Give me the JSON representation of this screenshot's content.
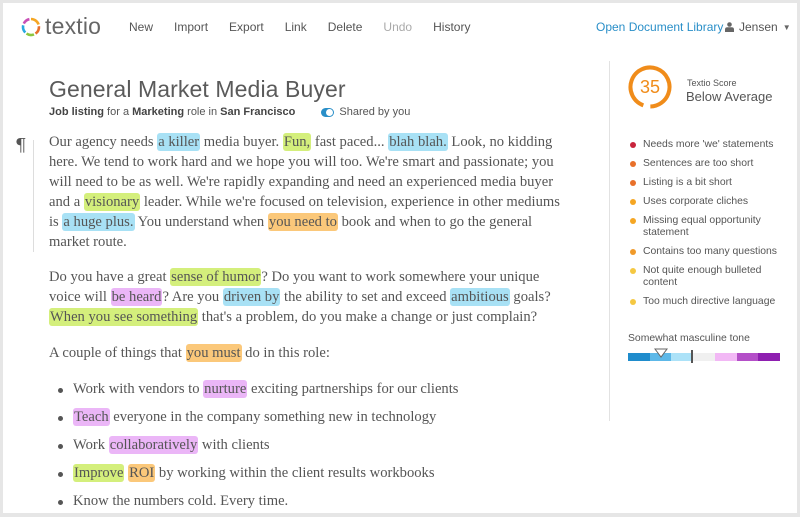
{
  "app": {
    "name": "textio"
  },
  "nav": {
    "items": [
      {
        "label": "New",
        "disabled": false
      },
      {
        "label": "Import",
        "disabled": false
      },
      {
        "label": "Export",
        "disabled": false
      },
      {
        "label": "Link",
        "disabled": false
      },
      {
        "label": "Delete",
        "disabled": false
      },
      {
        "label": "Undo",
        "disabled": true
      },
      {
        "label": "History",
        "disabled": false
      }
    ],
    "document_library": "Open Document Library",
    "user": "Jensen",
    "user_icon": "user-icon",
    "user_caret": "caret-down-icon"
  },
  "document": {
    "title": "General Market Media Buyer",
    "subtitle": {
      "prefix": "Job listing",
      "for_a": " for a ",
      "role": "Marketing",
      "role_in": " role in ",
      "location": "San Francisco"
    },
    "shared_label": "Shared by you",
    "pilcrow": "¶",
    "paragraphs": [
      [
        {
          "t": "Our agency needs "
        },
        {
          "t": "a killer",
          "hl": "blue"
        },
        {
          "t": " media buyer. "
        },
        {
          "t": "Fun,",
          "hl": "green"
        },
        {
          "t": " fast paced... "
        },
        {
          "t": "blah blah.",
          "hl": "blue"
        },
        {
          "t": " Look, no kidding here. We tend to work hard and we hope you will too. We're smart and passionate; you will need to be as well. We're rapidly expanding and need an experienced media buyer and a "
        },
        {
          "t": "visionary",
          "hl": "green"
        },
        {
          "t": " leader. While we're focused on television, experience in other mediums is "
        },
        {
          "t": "a huge plus.",
          "hl": "blue"
        },
        {
          "t": " You understand when "
        },
        {
          "t": "you need to",
          "hl": "orange"
        },
        {
          "t": " book and when to go the general market route."
        }
      ],
      [
        {
          "t": "Do you have a great "
        },
        {
          "t": "sense of humor",
          "hl": "green"
        },
        {
          "t": "? Do you want to work somewhere your unique voice will "
        },
        {
          "t": "be heard",
          "hl": "purple"
        },
        {
          "t": "? Are you "
        },
        {
          "t": "driven by",
          "hl": "blue"
        },
        {
          "t": " the ability to set and exceed "
        },
        {
          "t": "ambitious",
          "hl": "blue"
        },
        {
          "t": " goals? "
        },
        {
          "t": "When you see something",
          "hl": "green"
        },
        {
          "t": " that's a problem, do you make a change or just complain?"
        }
      ],
      [
        {
          "t": "A couple of things that "
        },
        {
          "t": "you must",
          "hl": "orange"
        },
        {
          "t": " do in this role:"
        }
      ]
    ],
    "bullets": [
      [
        {
          "t": "Work with vendors to "
        },
        {
          "t": "nurture",
          "hl": "purple"
        },
        {
          "t": " exciting partnerships for our clients"
        }
      ],
      [
        {
          "t": "Teach",
          "hl": "purple"
        },
        {
          "t": " everyone in the company something new in technology"
        }
      ],
      [
        {
          "t": "Work "
        },
        {
          "t": "collaboratively",
          "hl": "purple"
        },
        {
          "t": " with clients"
        }
      ],
      [
        {
          "t": "Improve",
          "hl": "green"
        },
        {
          "t": " "
        },
        {
          "t": "ROI",
          "hl": "orange"
        },
        {
          "t": " by working within the client results workbooks"
        }
      ],
      [
        {
          "t": "Know the numbers cold. Every time."
        }
      ]
    ]
  },
  "score": {
    "value": "35",
    "fraction": 0.35,
    "label": "Textio Score",
    "rating": "Below Average",
    "color": "#f08c1a"
  },
  "issues": [
    {
      "label": "Needs more 'we' statements",
      "color": "#c8243c"
    },
    {
      "label": "Sentences are too short",
      "color": "#e8702a"
    },
    {
      "label": "Listing is a bit short",
      "color": "#e8702a"
    },
    {
      "label": "Uses corporate cliches",
      "color": "#f5a623"
    },
    {
      "label": "Missing equal opportunity statement",
      "color": "#f5a623"
    },
    {
      "label": "Contains too many questions",
      "color": "#f09a2a"
    },
    {
      "label": "Not quite enough bulleted content",
      "color": "#f5c842"
    },
    {
      "label": "Too much directive language",
      "color": "#f5c842"
    }
  ],
  "tone": {
    "label": "Somewhat masculine tone",
    "position": 0.2,
    "segments": [
      "#1f8ccc",
      "#5db8e8",
      "#ace2f8",
      "#f0f0f0",
      "#f2b8f5",
      "#b44fc8",
      "#8e1fb0"
    ]
  },
  "highlight_colors": {
    "blue": "#a8e1f5",
    "green": "#d4ef7c",
    "orange": "#fbc87a",
    "purple": "#ebb6f7"
  },
  "accent": "#2a8fc8"
}
